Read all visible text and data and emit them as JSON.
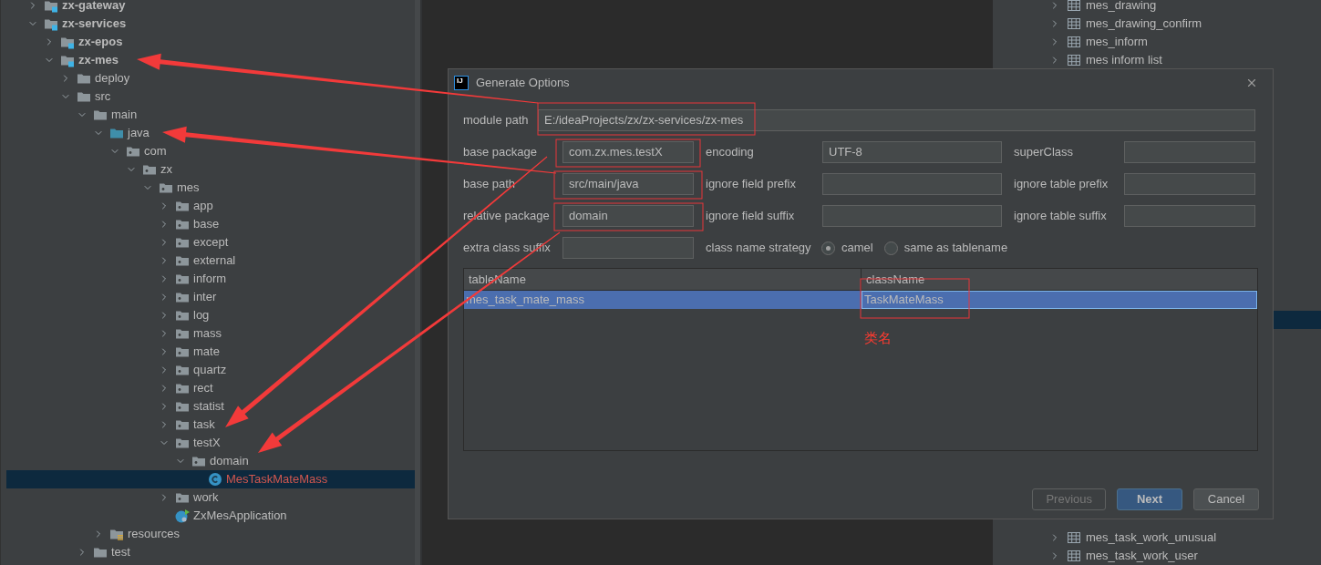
{
  "project_tree": [
    {
      "label": "zx-gateway",
      "kind": "module",
      "expanded": false,
      "selected": false
    },
    {
      "label": "zx-services",
      "kind": "module",
      "expanded": true,
      "selected": false,
      "children": [
        {
          "label": "zx-epos",
          "kind": "module",
          "expanded": false,
          "selected": false
        },
        {
          "label": "zx-mes",
          "kind": "module",
          "expanded": true,
          "selected": false,
          "children": [
            {
              "label": "deploy",
              "kind": "folder",
              "expanded": false,
              "selected": false
            },
            {
              "label": "src",
              "kind": "folder",
              "expanded": true,
              "selected": false,
              "children": [
                {
                  "label": "main",
                  "kind": "folder",
                  "expanded": true,
                  "selected": false,
                  "children": [
                    {
                      "label": "java",
                      "kind": "source_root",
                      "expanded": true,
                      "selected": false,
                      "children": [
                        {
                          "label": "com",
                          "kind": "package",
                          "expanded": true,
                          "selected": false,
                          "children": [
                            {
                              "label": "zx",
                              "kind": "package",
                              "expanded": true,
                              "selected": false,
                              "children": [
                                {
                                  "label": "mes",
                                  "kind": "package",
                                  "expanded": true,
                                  "selected": false,
                                  "children": [
                                    {
                                      "label": "app",
                                      "kind": "package",
                                      "expanded": false,
                                      "selected": false
                                    },
                                    {
                                      "label": "base",
                                      "kind": "package",
                                      "expanded": false,
                                      "selected": false
                                    },
                                    {
                                      "label": "except",
                                      "kind": "package",
                                      "expanded": false,
                                      "selected": false
                                    },
                                    {
                                      "label": "external",
                                      "kind": "package",
                                      "expanded": false,
                                      "selected": false
                                    },
                                    {
                                      "label": "inform",
                                      "kind": "package",
                                      "expanded": false,
                                      "selected": false
                                    },
                                    {
                                      "label": "inter",
                                      "kind": "package",
                                      "expanded": false,
                                      "selected": false
                                    },
                                    {
                                      "label": "log",
                                      "kind": "package",
                                      "expanded": false,
                                      "selected": false
                                    },
                                    {
                                      "label": "mass",
                                      "kind": "package",
                                      "expanded": false,
                                      "selected": false
                                    },
                                    {
                                      "label": "mate",
                                      "kind": "package",
                                      "expanded": false,
                                      "selected": false
                                    },
                                    {
                                      "label": "quartz",
                                      "kind": "package",
                                      "expanded": false,
                                      "selected": false
                                    },
                                    {
                                      "label": "rect",
                                      "kind": "package",
                                      "expanded": false,
                                      "selected": false
                                    },
                                    {
                                      "label": "statist",
                                      "kind": "package",
                                      "expanded": false,
                                      "selected": false
                                    },
                                    {
                                      "label": "task",
                                      "kind": "package",
                                      "expanded": false,
                                      "selected": false
                                    },
                                    {
                                      "label": "testX",
                                      "kind": "package",
                                      "expanded": true,
                                      "selected": false,
                                      "children": [
                                        {
                                          "label": "domain",
                                          "kind": "package",
                                          "expanded": true,
                                          "selected": false,
                                          "children": [
                                            {
                                              "label": "MesTaskMateMass",
                                              "kind": "class",
                                              "selected": true,
                                              "unversioned": true
                                            }
                                          ]
                                        }
                                      ]
                                    },
                                    {
                                      "label": "work",
                                      "kind": "package",
                                      "expanded": false,
                                      "selected": false
                                    },
                                    {
                                      "label": "ZxMesApplication",
                                      "kind": "app_class",
                                      "selected": false
                                    }
                                  ]
                                }
                              ]
                            }
                          ]
                        }
                      ]
                    },
                    {
                      "label": "resources",
                      "kind": "resources",
                      "expanded": false,
                      "selected": false
                    }
                  ]
                },
                {
                  "label": "test",
                  "kind": "folder",
                  "expanded": false,
                  "selected": false
                }
              ]
            }
          ]
        }
      ]
    }
  ],
  "database_tree": {
    "top_items": [
      {
        "label": "mes_drawing",
        "expanded": false
      },
      {
        "label": "mes_drawing_confirm",
        "expanded": false
      },
      {
        "label": "mes_inform",
        "expanded": false
      },
      {
        "label": "mes inform list",
        "expanded": false
      }
    ],
    "bottom_items": [
      {
        "label": "mes_task_work_unusual",
        "expanded": false
      },
      {
        "label": "mes_task_work_user",
        "expanded": false
      }
    ]
  },
  "dialog": {
    "logo": "IJ",
    "title": "Generate Options",
    "module_path": {
      "label": "module path",
      "value": "E:/ideaProjects/zx/zx-services/zx-mes"
    },
    "field_rows": [
      {
        "fields": [
          {
            "label": "base package",
            "value": "com.zx.mes.testX"
          },
          {
            "label": "encoding",
            "value": "UTF-8"
          },
          {
            "label": "superClass"
          }
        ]
      },
      {
        "fields": [
          {
            "label": "base path",
            "value": "src/main/java"
          },
          {
            "label": "ignore field prefix"
          },
          {
            "label": "ignore table prefix"
          }
        ]
      },
      {
        "fields": [
          {
            "label": "relative package",
            "value": "domain"
          },
          {
            "label": "ignore field suffix"
          },
          {
            "label": "ignore table suffix"
          }
        ]
      }
    ],
    "extra_class_suffix": {
      "label": "extra class suffix"
    },
    "class_name_strategy": {
      "label": "class name strategy",
      "options": [
        {
          "label": "camel",
          "selected": true
        },
        {
          "label": "same as tablename",
          "selected": false
        }
      ]
    },
    "table": {
      "columns": [
        "tableName",
        "className"
      ],
      "rows": [
        {
          "cells": [
            "mes_task_mate_mass",
            "TaskMateMass"
          ],
          "selected": true
        }
      ]
    },
    "buttons": [
      {
        "label": "Previous",
        "disabled": true,
        "default": false
      },
      {
        "label": "Next",
        "disabled": false,
        "default": true
      },
      {
        "label": "Cancel",
        "disabled": false,
        "default": false
      }
    ]
  },
  "annotation": {
    "label": "类名"
  }
}
